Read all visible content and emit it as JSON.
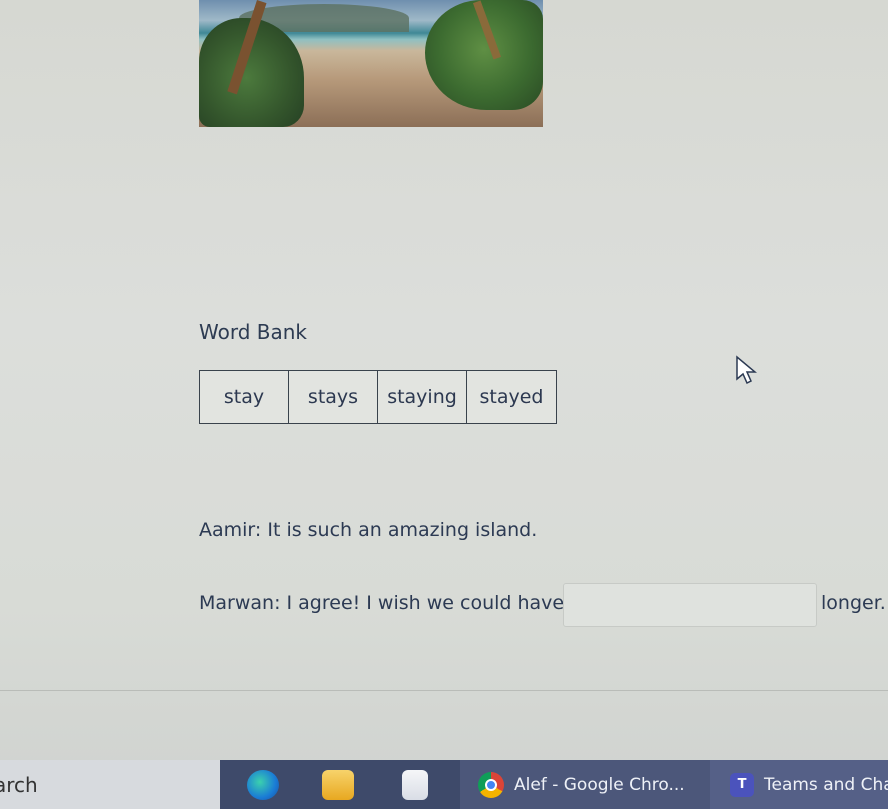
{
  "word_bank": {
    "title": "Word Bank",
    "words": [
      "stay",
      "stays",
      "staying",
      "stayed"
    ]
  },
  "dialogue": {
    "line1": "Aamir: It is such an amazing island.",
    "line2_before": "Marwan: I agree! I wish we could have",
    "blank_value": "",
    "line2_after": "longer."
  },
  "taskbar": {
    "search_text": "arch",
    "chrome_label": "Alef - Google Chro...",
    "teams_label": "Teams and Cha",
    "teams_glyph": "T"
  },
  "colors": {
    "text": "#2c3a53",
    "taskbar": "#3e4a6a"
  }
}
